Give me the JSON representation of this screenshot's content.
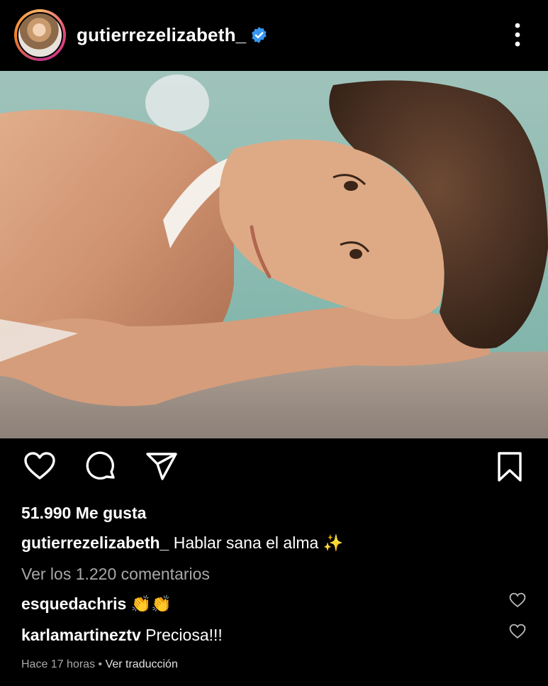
{
  "post": {
    "username": "gutierrezelizabeth_",
    "likes": "51.990 Me gusta",
    "caption_user": "gutierrezelizabeth_",
    "caption_text": "Hablar sana el alma ✨",
    "view_comments": "Ver los 1.220 comentarios",
    "comments": [
      {
        "user": "esquedachris",
        "text": "👏👏"
      },
      {
        "user": "karlamartineztv",
        "text": "Preciosa!!!"
      }
    ],
    "time": "Hace 17 horas",
    "separator": " • ",
    "translate": "Ver traducción"
  },
  "icons": {
    "verified": "verified-badge-icon",
    "more": "more-vertical-icon",
    "like": "heart-icon",
    "comment": "comment-icon",
    "share": "send-icon",
    "save": "bookmark-icon"
  },
  "colors": {
    "background": "#000000",
    "verified": "#3897f0",
    "muted": "#a8a8a8"
  }
}
